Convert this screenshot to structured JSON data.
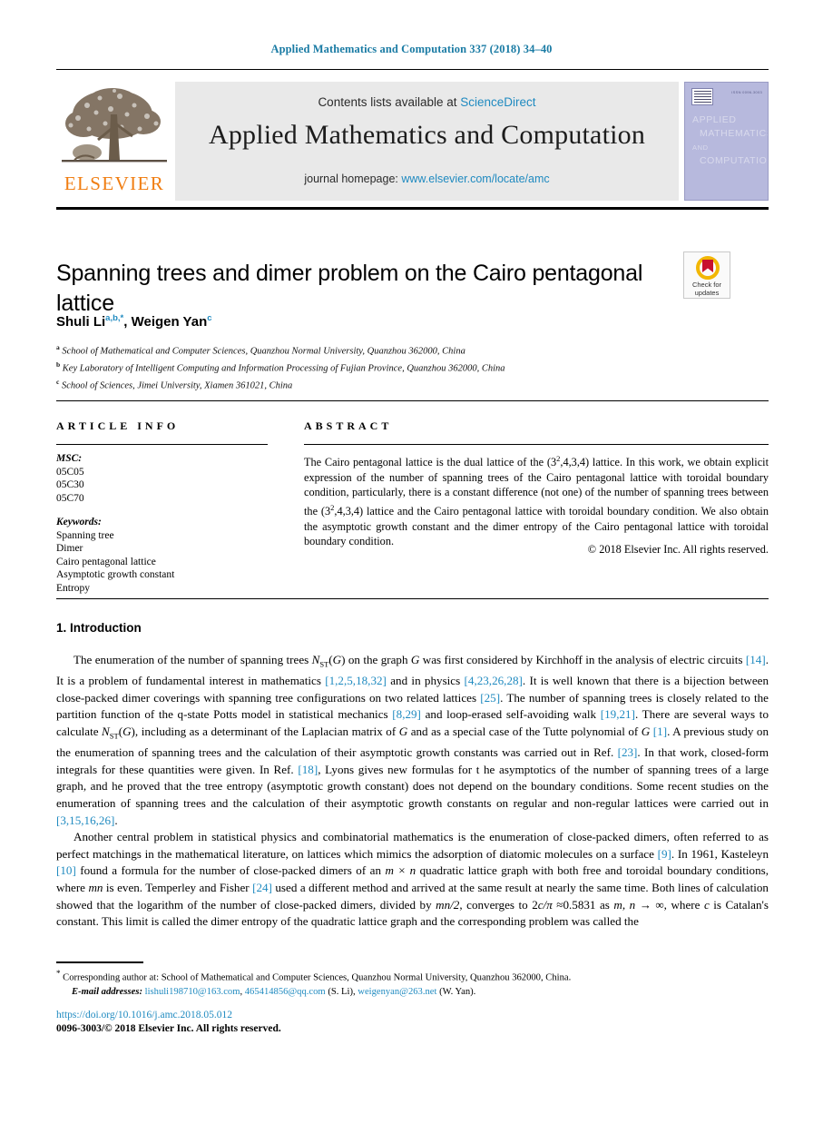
{
  "running_head": "Applied Mathematics and Computation 337 (2018) 34–40",
  "masthead": {
    "contents_prefix": "Contents lists available at ",
    "contents_link": "ScienceDirect",
    "journal_name": "Applied Mathematics and Computation",
    "homepage_prefix": "journal homepage: ",
    "homepage_link": "www.elsevier.com/locate/amc",
    "publisher_wordmark": "ELSEVIER",
    "cover": {
      "line1": "APPLIED",
      "line2": "MATHEMATICS",
      "line3": "AND",
      "line4": "COMPUTATION",
      "issn": "ISSN 0096-3003"
    }
  },
  "article": {
    "title": "Spanning trees and dimer problem on the Cairo pentagonal lattice",
    "authors": "Shuli Li, Weigen Yan",
    "author1_name": "Shuli Li",
    "author1_sup": "a,b,",
    "author1_star": "*",
    "author2_name": "Weigen Yan",
    "author2_sup": "c",
    "affiliations": [
      {
        "marker": "a",
        "text": "School of Mathematical and Computer Sciences, Quanzhou Normal University, Quanzhou 362000, China"
      },
      {
        "marker": "b",
        "text": "Key Laboratory of Intelligent Computing and Information Processing of Fujian Province, Quanzhou 362000, China"
      },
      {
        "marker": "c",
        "text": "School of Sciences, Jimei University, Xiamen 361021, China"
      }
    ]
  },
  "crossmark": {
    "line1": "Check for",
    "line2": "updates"
  },
  "article_info": {
    "heading": "ARTICLE INFO",
    "msc_label": "MSC:",
    "msc_codes": [
      "05C05",
      "05C30",
      "05C70"
    ],
    "keywords_label": "Keywords:",
    "keywords": [
      "Spanning tree",
      "Dimer",
      "Cairo pentagonal lattice",
      "Asymptotic growth constant",
      "Entropy"
    ]
  },
  "abstract": {
    "heading": "ABSTRACT",
    "part1": "The Cairo pentagonal lattice is the dual lattice of the (3",
    "sup1": "2",
    "part2": ",4,3,4) lattice. In this work, we obtain explicit expression of the number of spanning trees of the Cairo pentagonal lattice with toroidal boundary condition, particularly, there is a constant difference (not one) of the number of spanning trees between the (3",
    "sup2": "2",
    "part3": ",4,3,4) lattice and the Cairo pentagonal lattice with toroidal boundary condition. We also obtain the asymptotic growth constant and the dimer entropy of the Cairo pentagonal lattice with toroidal boundary condition.",
    "copyright": "© 2018 Elsevier Inc. All rights reserved."
  },
  "body": {
    "section_heading": "1. Introduction",
    "para1": {
      "t1": "The enumeration of the number of spanning trees ",
      "i1": "N",
      "sub1": "ST",
      "t2": "(",
      "i2": "G",
      "t3": ") on the graph ",
      "i3": "G",
      "t4": " was first considered by Kirchhoff in the analysis of electric circuits ",
      "r1": "[14]",
      "t5": ". It is a problem of fundamental interest in mathematics ",
      "r2": "[1,2,5,18,32]",
      "t6": " and in physics ",
      "r3": "[4,23,26,28]",
      "t7": ". It is well known that there is a bijection between close-packed dimer coverings with spanning tree configurations on two related lattices ",
      "r4": "[25]",
      "t8": ". The number of spanning trees is closely related to the partition function of the q-state Potts model in statistical mechanics ",
      "r5": "[8,29]",
      "t9": " and loop-erased self-avoiding walk ",
      "r6": "[19,21]",
      "t10": ". There are several ways to calculate ",
      "i4": "N",
      "sub2": "ST",
      "t11": "(",
      "i5": "G",
      "t12": "), including as a determinant of the Laplacian matrix of ",
      "i6": "G",
      "t13": " and as a special case of the Tutte polynomial of ",
      "i7": "G",
      "t14": " ",
      "r7": "[1]",
      "t15": ". A previous study on the enumeration of spanning trees and the calculation of their asymptotic growth constants was carried out in Ref. ",
      "r8": "[23]",
      "t16": ". In that work, closed-form integrals for these quantities were given. In Ref. ",
      "r9": "[18]",
      "t17": ", Lyons gives new formulas for t he asymptotics of the number of spanning trees of a large graph, and he proved that the tree entropy (asymptotic growth constant) does not depend on the boundary conditions. Some recent studies on the enumeration of spanning trees and the calculation of their asymptotic growth constants on regular and non-regular lattices were carried out in ",
      "r10": "[3,15,16,26]",
      "t18": "."
    },
    "para2": {
      "t1": "Another central problem in statistical physics and combinatorial mathematics is the enumeration of close-packed dimers, often referred to as perfect matchings in the mathematical literature, on lattices which mimics the adsorption of diatomic molecules on a surface ",
      "r1": "[9]",
      "t2": ". In 1961, Kasteleyn ",
      "r2": "[10]",
      "t3": " found a formula for the number of close-packed dimers of an ",
      "i1": "m × n",
      "t4": " quadratic lattice graph with both free and toroidal boundary conditions, where ",
      "i2": "mn",
      "t5": " is even. Temperley and Fisher ",
      "r3": "[24]",
      "t6": " used a different method and arrived at the same result at nearly the same time. Both lines of calculation showed that the logarithm of the number of close-packed dimers, divided by ",
      "i3": "mn/2",
      "t7": ", converges to 2",
      "i4": "c/π",
      "t8": " ≈0.5831 as ",
      "i5": "m, n",
      "t9": " → ∞, where ",
      "i6": "c",
      "t10": " is Catalan's constant. This limit is called the dimer entropy of the quadratic lattice graph and the corresponding problem was called the"
    }
  },
  "footer": {
    "star": "*",
    "corresponding": " Corresponding author at: School of Mathematical and Computer Sciences, Quanzhou Normal University, Quanzhou 362000, China.",
    "email_label": "E-mail addresses:",
    "email1": "lishuli198710@163.com",
    "email2": "465414856@qq.com",
    "email_author1": " (S. Li),",
    "email3": "weigenyan@263.net",
    "email_author2": " (W. Yan).",
    "doi": "https://doi.org/10.1016/j.amc.2018.05.012",
    "issn_line": "0096-3003/© 2018 Elsevier Inc. All rights reserved."
  }
}
